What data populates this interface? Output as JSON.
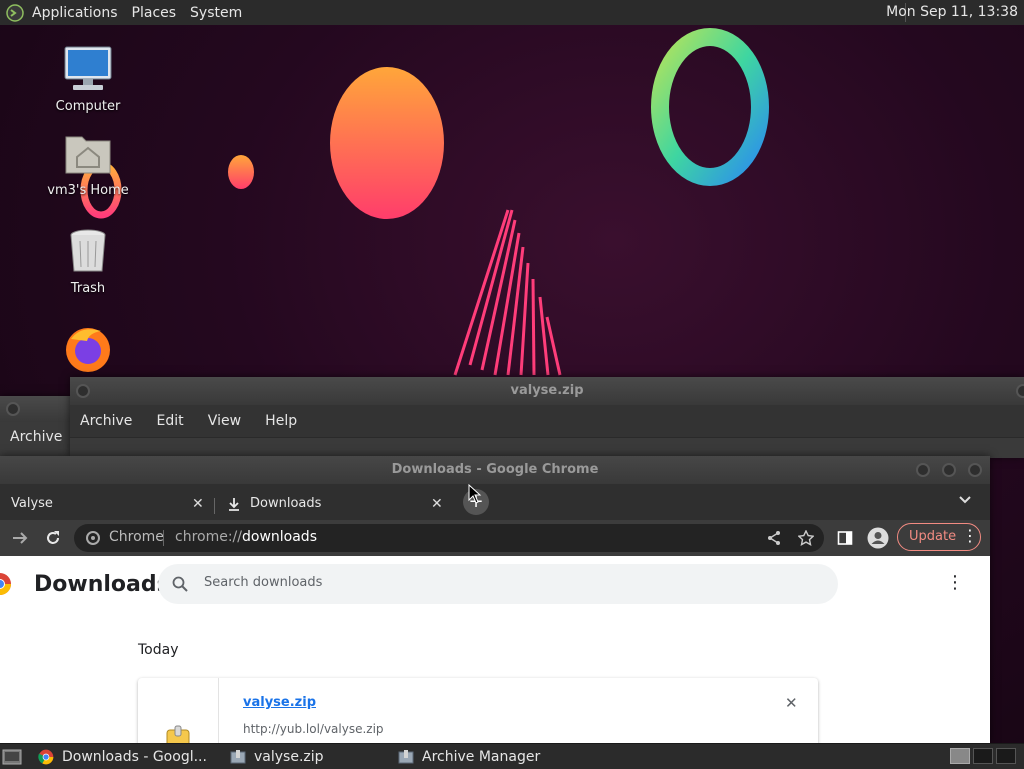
{
  "top_panel": {
    "menus": [
      "Applications",
      "Places",
      "System"
    ],
    "clock": "Mon Sep 11, 13:38"
  },
  "desktop": {
    "icons": [
      {
        "label": "Computer",
        "icon": "computer-icon"
      },
      {
        "label": "vm3's Home",
        "icon": "home-folder-icon"
      },
      {
        "label": "Trash",
        "icon": "trash-icon"
      },
      {
        "label": "",
        "icon": "firefox-icon"
      }
    ]
  },
  "archive_bg_window": {
    "menu": "Archive"
  },
  "archive_window": {
    "title": "valyse.zip",
    "menus": [
      "Archive",
      "Edit",
      "View",
      "Help"
    ]
  },
  "chrome": {
    "title": "Downloads - Google Chrome",
    "tabs": [
      {
        "label": "Valyse",
        "active": false
      },
      {
        "label": "Downloads",
        "active": true
      }
    ],
    "omnibox": {
      "scheme_label": "Chrome",
      "url_prefix": "chrome://",
      "url_host": "downloads"
    },
    "update_label": "Update",
    "page": {
      "title": "Downloads",
      "search_placeholder": "Search downloads",
      "section": "Today",
      "item": {
        "filename": "valyse.zip",
        "url": "http://yub.lol/valyse.zip"
      }
    }
  },
  "taskbar": {
    "tasks": [
      {
        "label": "Downloads - Googl...",
        "icon": "chrome-icon"
      },
      {
        "label": "valyse.zip",
        "icon": "archive-icon"
      },
      {
        "label": "Archive Manager",
        "icon": "archive-icon"
      }
    ]
  },
  "colors": {
    "accent_update": "#f28b82",
    "link": "#1a73e8"
  }
}
